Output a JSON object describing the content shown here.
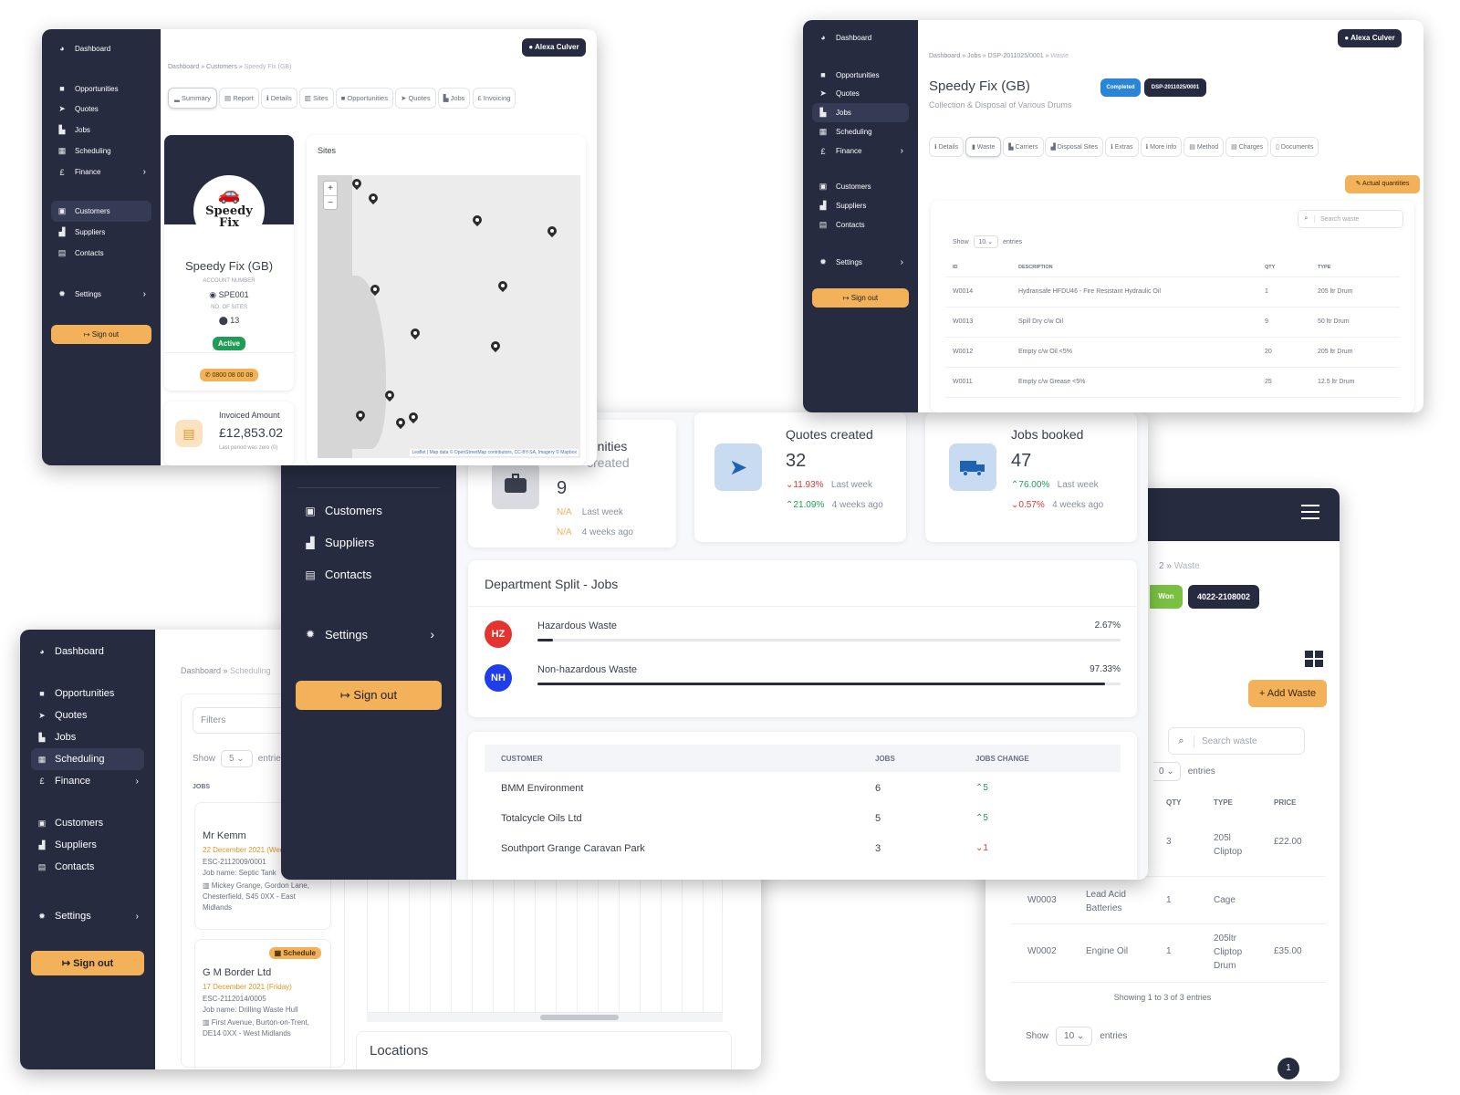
{
  "win1": {
    "sidebar": {
      "dashboard": "Dashboard",
      "items": [
        "Opportunities",
        "Quotes",
        "Jobs",
        "Scheduling",
        "Finance"
      ],
      "items2": [
        "Customers",
        "Suppliers",
        "Contacts"
      ],
      "settings": "Settings",
      "signout": "Sign out"
    },
    "user": "Alexa Culver",
    "breadcrumb": [
      "Dashboard",
      "Customers",
      "Speedy Fix (GB)"
    ],
    "tabs": [
      "Summary",
      "Report",
      "Details",
      "Sites",
      "Opportunities",
      "Quotes",
      "Jobs",
      "Invoicing"
    ],
    "profile": {
      "logo_line1": "Speedy",
      "logo_line2": "Fix",
      "name": "Speedy Fix (GB)",
      "account_label": "ACCOUNT NUMBER",
      "account": "SPE001",
      "sites_label": "NO. OF SITES",
      "sites": "13",
      "status": "Active",
      "phone": "0800 08 00 08"
    },
    "invoiced": {
      "label": "Invoiced Amount",
      "amount": "£12,853.02",
      "note": "Last period was zero (0)"
    },
    "sites_title": "Sites",
    "map_attrib": "Leaflet | Map data © OpenStreetMap contributors, CC-BY-SA, Imagery © Mapbox",
    "zoom_in": "+",
    "zoom_out": "−"
  },
  "win2": {
    "sidebar": {
      "dashboard": "Dashboard",
      "items": [
        "Opportunities",
        "Quotes",
        "Jobs",
        "Scheduling",
        "Finance"
      ],
      "items2": [
        "Customers",
        "Suppliers",
        "Contacts"
      ],
      "settings": "Settings",
      "signout": "Sign out"
    },
    "user": "Alexa Culver",
    "breadcrumb": [
      "Dashboard",
      "Jobs",
      "DSP-2011025/0001",
      "Waste"
    ],
    "title": "Speedy Fix (GB)",
    "subtitle": "Collection & Disposal of Various Drums",
    "badge_status": "Completed",
    "badge_ref": "DSP-2011025/0001",
    "tabs": [
      "Details",
      "Waste",
      "Carriers",
      "Disposal Sites",
      "Extras",
      "More info",
      "Method",
      "Charges",
      "Documents"
    ],
    "actual_btn": "Actual quantities",
    "search_placeholder": "Search waste",
    "show": "Show",
    "show_val": "10",
    "entries": "entries",
    "headers": [
      "ID",
      "DESCRIPTION",
      "QTY",
      "TYPE"
    ],
    "rows": [
      {
        "id": "W0014",
        "desc": "Hydransafe HFDU46 - Fire Resistant Hydraulic Oil",
        "qty": "1",
        "type": "205 ltr Drum"
      },
      {
        "id": "W0013",
        "desc": "Spill Dry c/w Oil",
        "qty": "9",
        "type": "50 ltr Drum"
      },
      {
        "id": "W0012",
        "desc": "Empty c/w Oil <5%",
        "qty": "20",
        "type": "205 ltr Drum"
      },
      {
        "id": "W0011",
        "desc": "Empty c/w Grease <5%",
        "qty": "25",
        "type": "12.5 ltr Drum"
      }
    ]
  },
  "win3": {
    "sidebar": {
      "dashboard": "Dashboard",
      "items": [
        "Opportunities",
        "Quotes",
        "Jobs",
        "Scheduling",
        "Finance"
      ],
      "items2": [
        "Customers",
        "Suppliers",
        "Contacts"
      ],
      "settings": "Settings",
      "signout": "Sign out"
    },
    "breadcrumb": [
      "Dashboard",
      "Scheduling"
    ],
    "filters": "Filters",
    "show": "Show",
    "show_val": "5",
    "entries": "entries",
    "jobs_header": "JOBS",
    "jobs": [
      {
        "name": "Mr Kemm",
        "date": "22 December 2021 (Wed",
        "ref": "ESC-2112009/0001",
        "jobname": "Job name: Septic Tank",
        "address": "Mickey Grange, Gordon Lane, Chesterfield, S45 0XX - East Midlands",
        "badge": "S"
      },
      {
        "name": "G M Border Ltd",
        "date": "17 December 2021 (Friday)",
        "ref": "ESC-2112014/0005",
        "jobname": "Job name: Drilling Waste Hull",
        "address": "First Avenue, Burton-on-Trent, DE14 0XX - West Midlands",
        "badge": "Schedule"
      }
    ],
    "locations": "Locations"
  },
  "win4": {
    "sidebar": {
      "items2": [
        "Customers",
        "Suppliers",
        "Contacts"
      ],
      "settings": "Settings",
      "signout": "Sign out"
    },
    "stats": [
      {
        "title_a": "tunities",
        "title_b": "created",
        "value": "9",
        "c1": "N/A",
        "c1_label": "Last week",
        "c2": "N/A",
        "c2_label": "4 weeks ago"
      },
      {
        "title_a": "Quotes created",
        "value": "32",
        "c1": "11.93%",
        "c1_label": "Last week",
        "c2": "21.09%",
        "c2_label": "4 weeks ago"
      },
      {
        "title_a": "Jobs booked",
        "value": "47",
        "c1": "76.00%",
        "c1_label": "Last week",
        "c2": "0.57%",
        "c2_label": "4 weeks ago"
      }
    ],
    "dept": {
      "title": "Department Split - Jobs",
      "rows": [
        {
          "code": "HZ",
          "label": "Hazardous Waste",
          "pct": "2.67%",
          "value": 2.67,
          "color": "#e3342f"
        },
        {
          "code": "NH",
          "label": "Non-hazardous Waste",
          "pct": "97.33%",
          "value": 97.33,
          "color": "#1d3ee8"
        }
      ]
    },
    "customers": {
      "headers": [
        "CUSTOMER",
        "JOBS",
        "JOBS CHANGE"
      ],
      "rows": [
        {
          "name": "BMM Environment",
          "jobs": "6",
          "change": "5",
          "dir": "up"
        },
        {
          "name": "Totalcycle Oils Ltd",
          "jobs": "5",
          "change": "5",
          "dir": "up"
        },
        {
          "name": "Southport Grange Caravan Park",
          "jobs": "3",
          "change": "1",
          "dir": "down"
        }
      ]
    }
  },
  "win5": {
    "breadcrumb_num": "2",
    "breadcrumb_cur": "Waste",
    "badge_status": "Won",
    "badge_ref": "4022-2108002",
    "add_btn": "Add Waste",
    "search_placeholder": "Search waste",
    "show_top_val": "0",
    "entries": "entries",
    "headers": [
      "QTY",
      "TYPE",
      "PRICE"
    ],
    "rows": [
      {
        "id": "",
        "desc": "",
        "qty": "3",
        "type": "205l Cliptop",
        "price": "£22.00"
      },
      {
        "id": "W0003",
        "desc": "Lead Acid Batteries",
        "qty": "1",
        "type": "Cage",
        "price": ""
      },
      {
        "id": "W0002",
        "desc": "Engine Oil",
        "qty": "1",
        "type": "205ltr Cliptop Drum",
        "price": "£35.00"
      }
    ],
    "showing": "Showing 1 to 3 of 3 entries",
    "show": "Show",
    "show_val": "10",
    "page": "1"
  }
}
